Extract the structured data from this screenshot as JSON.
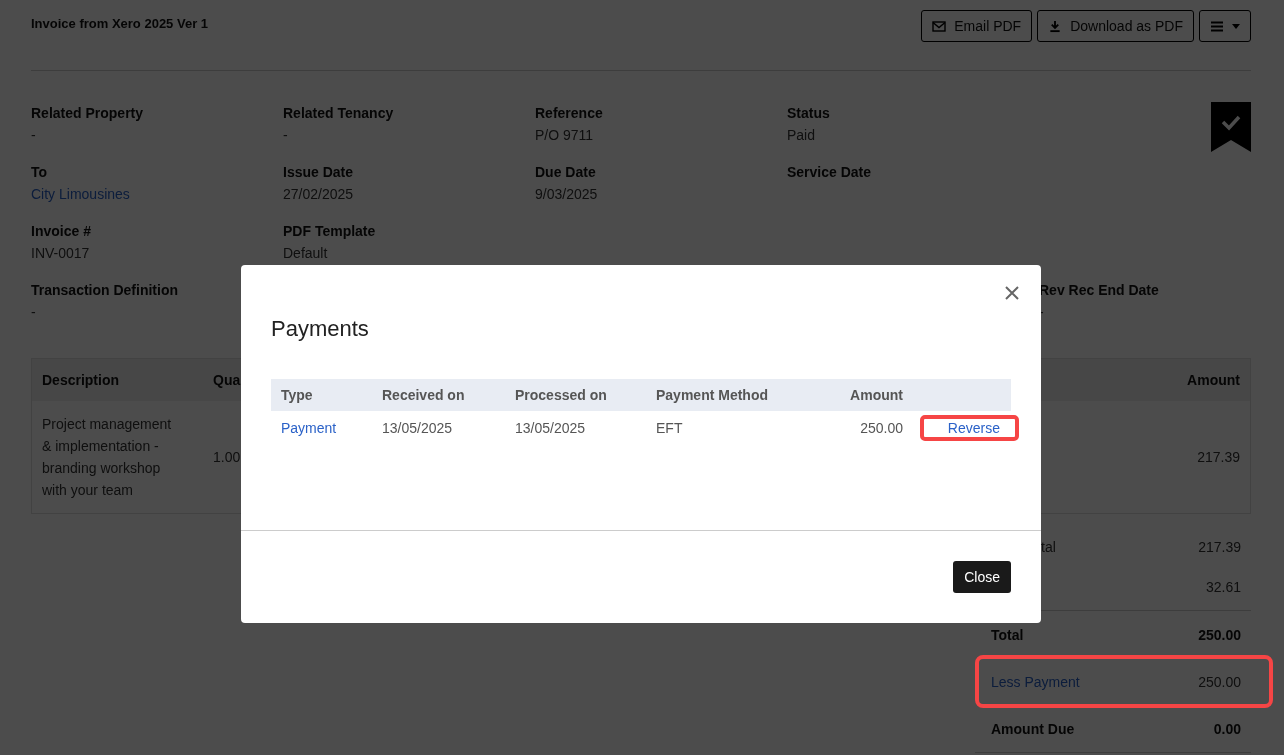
{
  "page": {
    "title": "Invoice from Xero 2025 Ver 1",
    "actions": [
      {
        "kind": "email",
        "label": "Email PDF"
      },
      {
        "kind": "download",
        "label": "Download as PDF"
      },
      {
        "kind": "menu"
      }
    ]
  },
  "fields": [
    [
      {
        "label": "Related Property",
        "value": "-"
      },
      {
        "label": "Related Tenancy",
        "value": "-"
      },
      {
        "label": "Reference",
        "value": "P/O 9711"
      },
      {
        "label": "Status",
        "value": "Paid"
      }
    ],
    [
      {
        "label": "To",
        "value": "City Limousines",
        "kind": "link"
      },
      {
        "label": "Issue Date",
        "value": "27/02/2025"
      },
      {
        "label": "Due Date",
        "value": "9/03/2025"
      },
      {
        "label": "Service Date"
      }
    ],
    [
      {
        "label": "Invoice #",
        "value": "INV-0017"
      },
      {
        "label": "PDF Template",
        "value": "Default"
      }
    ],
    [
      {
        "label": "Transaction Definition",
        "value": "-"
      },
      {
        "label": "Rev Rec End Date",
        "value": "-",
        "kind": "far"
      }
    ]
  ],
  "line_items": {
    "columns": [
      "Description",
      "Qua",
      "Amount"
    ],
    "rows": [
      {
        "description": "Project management & implementation - branding workshop with your team",
        "quantity": "1.00",
        "amount": "217.39"
      }
    ]
  },
  "totals": [
    {
      "kind": "partial",
      "label": "tal",
      "value": "217.39",
      "highlighted": false
    },
    {
      "kind": "plain",
      "value": "32.61",
      "highlighted": false
    },
    {
      "kind": "total",
      "label": "Total",
      "value": "250.00",
      "highlighted": false
    },
    {
      "kind": "link",
      "label": "Less Payment",
      "value": "250.00",
      "highlighted": true
    },
    {
      "kind": "total",
      "label": "Amount Due",
      "value": "0.00",
      "highlighted": false
    }
  ],
  "modal": {
    "title": "Payments",
    "columns": [
      "Type",
      "Received on",
      "Processed on",
      "Payment Method",
      "Amount"
    ],
    "rows": [
      {
        "type": "Payment",
        "received_on": "13/05/2025",
        "processed_on": "13/05/2025",
        "method": "EFT",
        "amount": "250.00",
        "action": "Reverse",
        "highlighted": true
      }
    ],
    "close_label": "Close"
  }
}
